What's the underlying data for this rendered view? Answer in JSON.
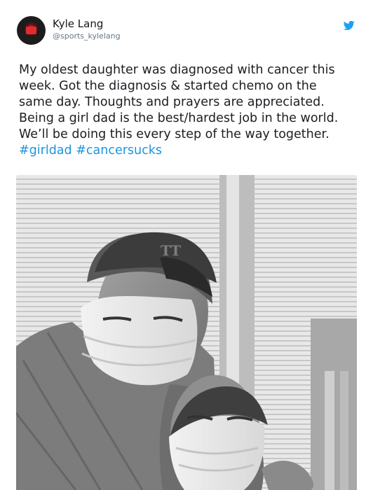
{
  "user": {
    "display_name": "Kyle Lang",
    "handle": "@sports_kylelang",
    "avatar_icon": "profile-avatar"
  },
  "tweet": {
    "lines": [
      "My oldest daughter was diagnosed with cancer this",
      "week. Got the diagnosis & started chemo on the",
      "same day. Thoughts and prayers are appreciated.",
      "Being a girl dad is the best/hardest job in the world.",
      "We’ll be doing this every step of the way together."
    ],
    "hashtags": [
      "#girldad",
      "#cancersucks"
    ]
  },
  "media": {
    "kind": "photo",
    "style": "black-and-white"
  },
  "icons": {
    "platform": "twitter-bird-icon"
  },
  "colors": {
    "accent": "#1b95e0",
    "text": "#14171a",
    "secondary": "#657786"
  }
}
